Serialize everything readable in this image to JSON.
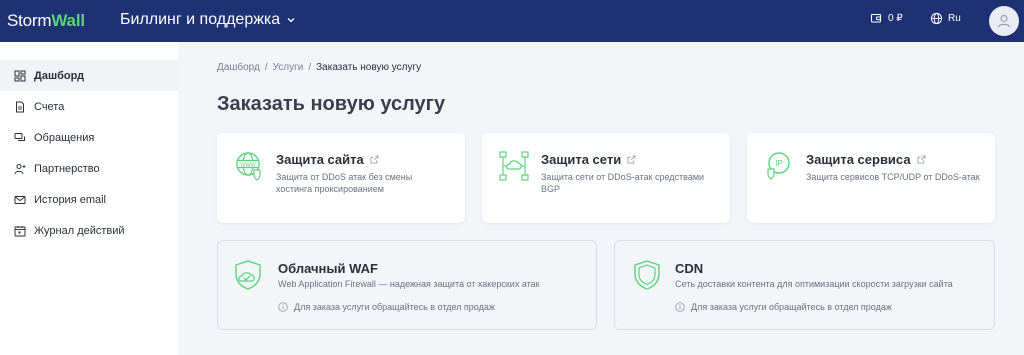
{
  "header": {
    "logo_part1": "Storm",
    "logo_part2": "Wall",
    "title": "Биллинг и поддержка",
    "balance": "0 ₽",
    "language": "Ru"
  },
  "sidebar": {
    "items": [
      {
        "label": "Дашборд"
      },
      {
        "label": "Счета"
      },
      {
        "label": "Обращения"
      },
      {
        "label": "Партнерство"
      },
      {
        "label": "История email"
      },
      {
        "label": "Журнал действий"
      }
    ]
  },
  "breadcrumb": {
    "items": [
      "Дашборд",
      "Услуги",
      "Заказать новую услугу"
    ],
    "separator": "/"
  },
  "page": {
    "title": "Заказать новую услугу"
  },
  "services": [
    {
      "title": "Защита сайта",
      "description": "Защита от DDoS атак без смены хостинга проксированием"
    },
    {
      "title": "Защита сети",
      "description": "Защита сети от DDoS-атак средствами BGP"
    },
    {
      "title": "Защита сервиса",
      "description": "Защита сервисов TCP/UDP от DDoS-атак"
    }
  ],
  "sales_services": [
    {
      "title": "Облачный WAF",
      "description": "Web Application Firewall — надежная защита от хакерских атак",
      "note": "Для заказа услуги обращайтесь в отдел продаж"
    },
    {
      "title": "CDN",
      "description": "Сеть доставки контента для оптимизации скорости загрузки сайта",
      "note": "Для заказа услуги обращайтесь в отдел продаж"
    }
  ],
  "colors": {
    "header_bg": "#1e3273",
    "accent_green": "#5bd37b",
    "page_bg": "#f3f5f9"
  }
}
